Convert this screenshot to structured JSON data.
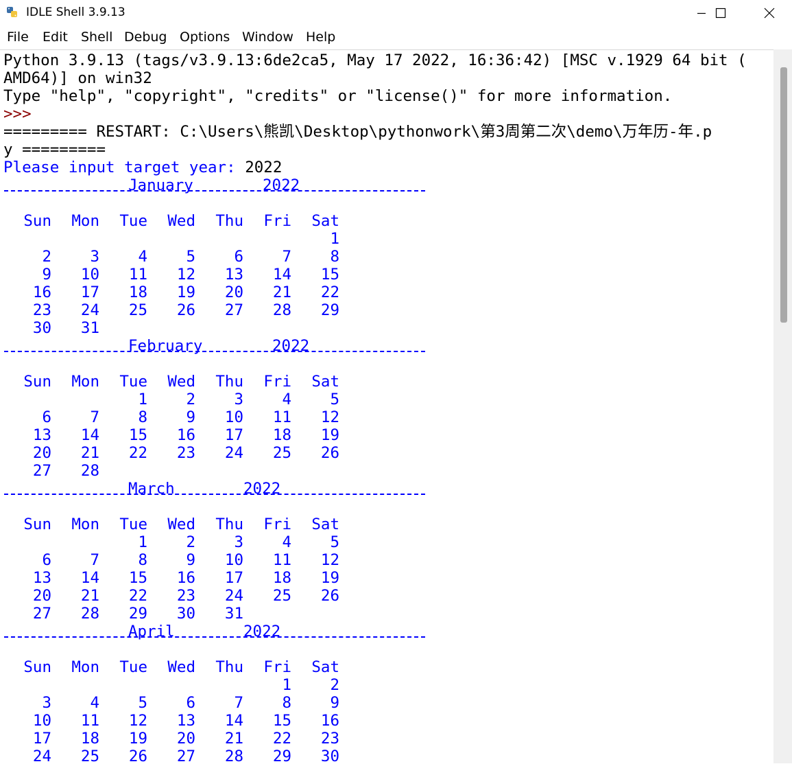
{
  "window": {
    "title": "IDLE Shell 3.9.13",
    "icon": "python-icon",
    "controls": [
      "minimize-icon",
      "maximize-icon",
      "close-icon"
    ]
  },
  "menu": [
    "File",
    "Edit",
    "Shell",
    "Debug",
    "Options",
    "Window",
    "Help"
  ],
  "shell": {
    "banner_line1": "Python 3.9.13 (tags/v3.9.13:6de2ca5, May 17 2022, 16:36:42) [MSC v.1929 64 bit (",
    "banner_line2": "AMD64)] on win32",
    "banner_line3": "Type \"help\", \"copyright\", \"credits\" or \"license()\" for more information.",
    "prompt": ">>>",
    "restart_line1": "========= RESTART: C:\\Users\\熊凯\\Desktop\\pythonwork\\第3周第二次\\demo\\万年历-年.p",
    "restart_line2": "y =========",
    "input_prompt": "Please input target year: ",
    "input_value": "2022"
  },
  "weekdays": [
    "Sun",
    "Mon",
    "Tue",
    "Wed",
    "Thu",
    "Fri",
    "Sat"
  ],
  "months": [
    {
      "name": "January",
      "year": "2022",
      "weeks": [
        [
          "",
          "",
          "",
          "",
          "",
          "",
          "1"
        ],
        [
          "2",
          "3",
          "4",
          "5",
          "6",
          "7",
          "8"
        ],
        [
          "9",
          "10",
          "11",
          "12",
          "13",
          "14",
          "15"
        ],
        [
          "16",
          "17",
          "18",
          "19",
          "20",
          "21",
          "22"
        ],
        [
          "23",
          "24",
          "25",
          "26",
          "27",
          "28",
          "29"
        ],
        [
          "30",
          "31",
          "",
          "",
          "",
          "",
          ""
        ]
      ]
    },
    {
      "name": "February",
      "year": "2022",
      "weeks": [
        [
          "",
          "",
          "1",
          "2",
          "3",
          "4",
          "5"
        ],
        [
          "6",
          "7",
          "8",
          "9",
          "10",
          "11",
          "12"
        ],
        [
          "13",
          "14",
          "15",
          "16",
          "17",
          "18",
          "19"
        ],
        [
          "20",
          "21",
          "22",
          "23",
          "24",
          "25",
          "26"
        ],
        [
          "27",
          "28",
          "",
          "",
          "",
          "",
          ""
        ]
      ]
    },
    {
      "name": "March",
      "year": "2022",
      "weeks": [
        [
          "",
          "",
          "1",
          "2",
          "3",
          "4",
          "5"
        ],
        [
          "6",
          "7",
          "8",
          "9",
          "10",
          "11",
          "12"
        ],
        [
          "13",
          "14",
          "15",
          "16",
          "17",
          "18",
          "19"
        ],
        [
          "20",
          "21",
          "22",
          "23",
          "24",
          "25",
          "26"
        ],
        [
          "27",
          "28",
          "29",
          "30",
          "31",
          "",
          ""
        ]
      ]
    },
    {
      "name": "April",
      "year": "2022",
      "weeks": [
        [
          "",
          "",
          "",
          "",
          "",
          "1",
          "2"
        ],
        [
          "3",
          "4",
          "5",
          "6",
          "7",
          "8",
          "9"
        ],
        [
          "10",
          "11",
          "12",
          "13",
          "14",
          "15",
          "16"
        ],
        [
          "17",
          "18",
          "19",
          "20",
          "21",
          "22",
          "23"
        ],
        [
          "24",
          "25",
          "26",
          "27",
          "28",
          "29",
          "30"
        ]
      ]
    }
  ]
}
